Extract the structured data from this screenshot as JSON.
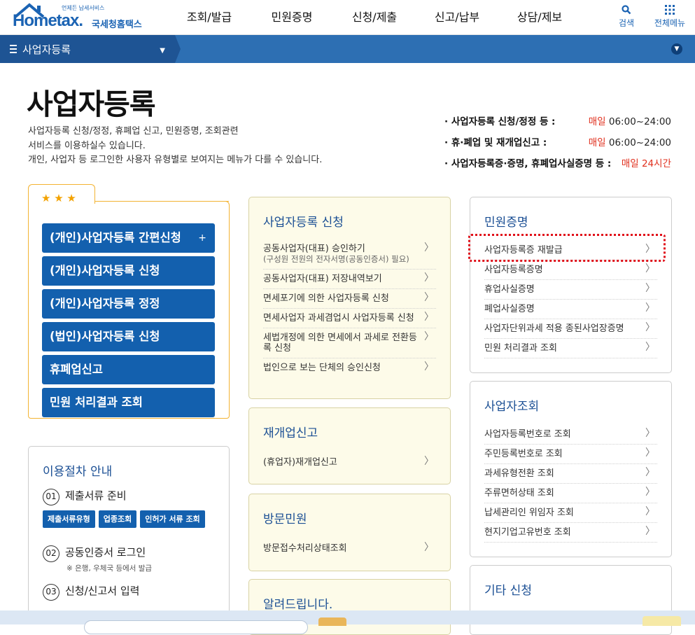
{
  "header": {
    "logo_text": "Hometax.",
    "logo_small": "언제든 납세서비스",
    "logo_kr": "국세청홈택스",
    "gnb": [
      "조회/발급",
      "민원증명",
      "신청/제출",
      "신고/납부",
      "상담/제보"
    ],
    "search_label": "검색",
    "menu_label": "전체메뉴"
  },
  "nav": {
    "crumb": "사업자등록"
  },
  "page": {
    "title": "사업자등록",
    "desc": [
      "사업자등록 신청/정정, 휴폐업 신고, 민원증명, 조회관련",
      "서비스를 이용하실수 있습니다.",
      "개인, 사업자 등 로그인한 사용자 유형별로 보여지는 메뉴가 다를 수 있습니다."
    ],
    "hours": [
      {
        "label": "· 사업자등록 신청/정정 등 :",
        "day": "매일",
        "time": "06:00~24:00"
      },
      {
        "label": "· 휴·폐업 및 재개업신고 :",
        "day": "매일",
        "time": "06:00~24:00"
      },
      {
        "label": "· 사업자등록증·증명, 휴폐업사실증명 등 :",
        "day": "매일",
        "time": "24시간"
      }
    ]
  },
  "favorites": {
    "stars": "★ ★ ★",
    "buttons": [
      "(개인)사업자등록 간편신청",
      "(개인)사업자등록 신청",
      "(개인)사업자등록 정정",
      "(법인)사업자등록 신청",
      "휴폐업신고",
      "민원 처리결과 조회"
    ],
    "plus": "+"
  },
  "procedure": {
    "title": "이용절차 안내",
    "steps": [
      {
        "num": "01",
        "label": "제출서류 준비"
      },
      {
        "num": "02",
        "label": "공동인증서 로그인",
        "note": "※ 은행, 우체국 등에서 발급"
      },
      {
        "num": "03",
        "label": "신청/신고서 입력"
      }
    ],
    "chips": [
      "제출서류유형",
      "업종조회",
      "인허가 서류 조회"
    ]
  },
  "register": {
    "title": "사업자등록 신청",
    "items": [
      {
        "label": "공동사업자(대표) 승인하기",
        "sub": "(구성원 전원의 전자서명(공동인증서) 필요)"
      },
      {
        "label": "공동사업자(대표) 저장내역보기"
      },
      {
        "label": "면세포기에 의한 사업자등록 신청"
      },
      {
        "label": "면세사업자 과세겸업시 사업자등록 신청"
      },
      {
        "label": "세법개정에 의한 면세에서 과세로 전환등록 신청"
      },
      {
        "label": "법인으로 보는 단체의 승인신청"
      }
    ]
  },
  "reopen": {
    "title": "재개업신고",
    "items": [
      {
        "label": "(휴업자)재개업신고"
      }
    ]
  },
  "visit": {
    "title": "방문민원",
    "items": [
      {
        "label": "방문접수처리상태조회"
      }
    ]
  },
  "notice": {
    "title": "알려드립니다."
  },
  "certs": {
    "title": "민원증명",
    "items": [
      "사업자등록증 재발급",
      "사업자등록증명",
      "휴업사실증명",
      "폐업사실증명",
      "사업자단위과세 적용 종된사업장증명",
      "민원 처리결과 조회"
    ]
  },
  "lookup": {
    "title": "사업자조회",
    "items": [
      "사업자등록번호로 조회",
      "주민등록번호로 조회",
      "과세유형전환 조회",
      "주류면허상태 조회",
      "납세관리인 위임자 조회",
      "현지기업고유번호 조회"
    ]
  },
  "other": {
    "title": "기타 신청"
  },
  "chev": "〉"
}
